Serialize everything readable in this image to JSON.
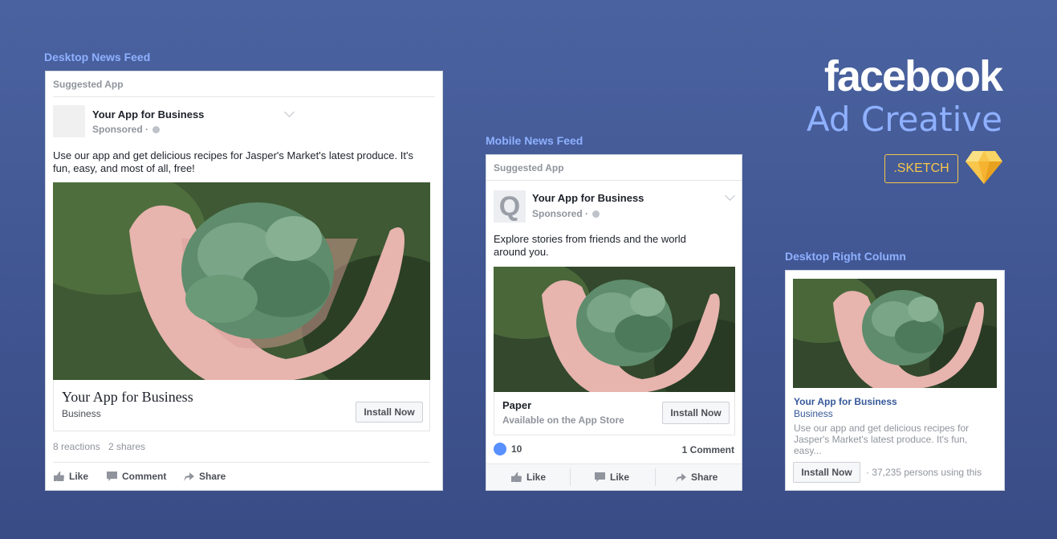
{
  "labels": {
    "desktop_feed": "Desktop News Feed",
    "mobile_feed": "Mobile News Feed",
    "right_column": "Desktop Right Column"
  },
  "brand": {
    "logo": "facebook",
    "subtitle": "Ad Creative",
    "sketch_badge": ".SKETCH",
    "sketch_icon": "sketch-diamond-icon"
  },
  "desktop": {
    "header": "Suggested App",
    "page_name": "Your App for Business",
    "sponsored": "Sponsored ·",
    "body": "Use our app and get delicious recipes for Jasper's Market's latest produce. It's fun, easy, and most of all, free!",
    "app_title": "Your App for Business",
    "app_category": "Business",
    "cta": "Install Now",
    "reactions": "8 reactions",
    "shares": "2 shares",
    "actions": [
      "Like",
      "Comment",
      "Share"
    ]
  },
  "mobile": {
    "header": "Suggested App",
    "avatar_letter": "Q",
    "page_name": "Your App for Business",
    "sponsored": "Sponsored ·",
    "body": "Explore stories from friends and the world around you.",
    "app_title": "Paper",
    "app_sub": "Available on the App Store",
    "cta": "Install Now",
    "like_count": "10",
    "comments": "1 Comment",
    "actions": [
      "Like",
      "Like",
      "Share"
    ]
  },
  "right": {
    "title": "Your App for Business",
    "category": "Business",
    "body": "Use our app and get delicious recipes for Jasper's Market's latest produce. It's fun, easy...",
    "cta": "Install Now",
    "users": "· 37,235 persons using this"
  },
  "colors": {
    "accent": "#8fb0ff",
    "link": "#365899",
    "sketch": "#f7c64a"
  }
}
